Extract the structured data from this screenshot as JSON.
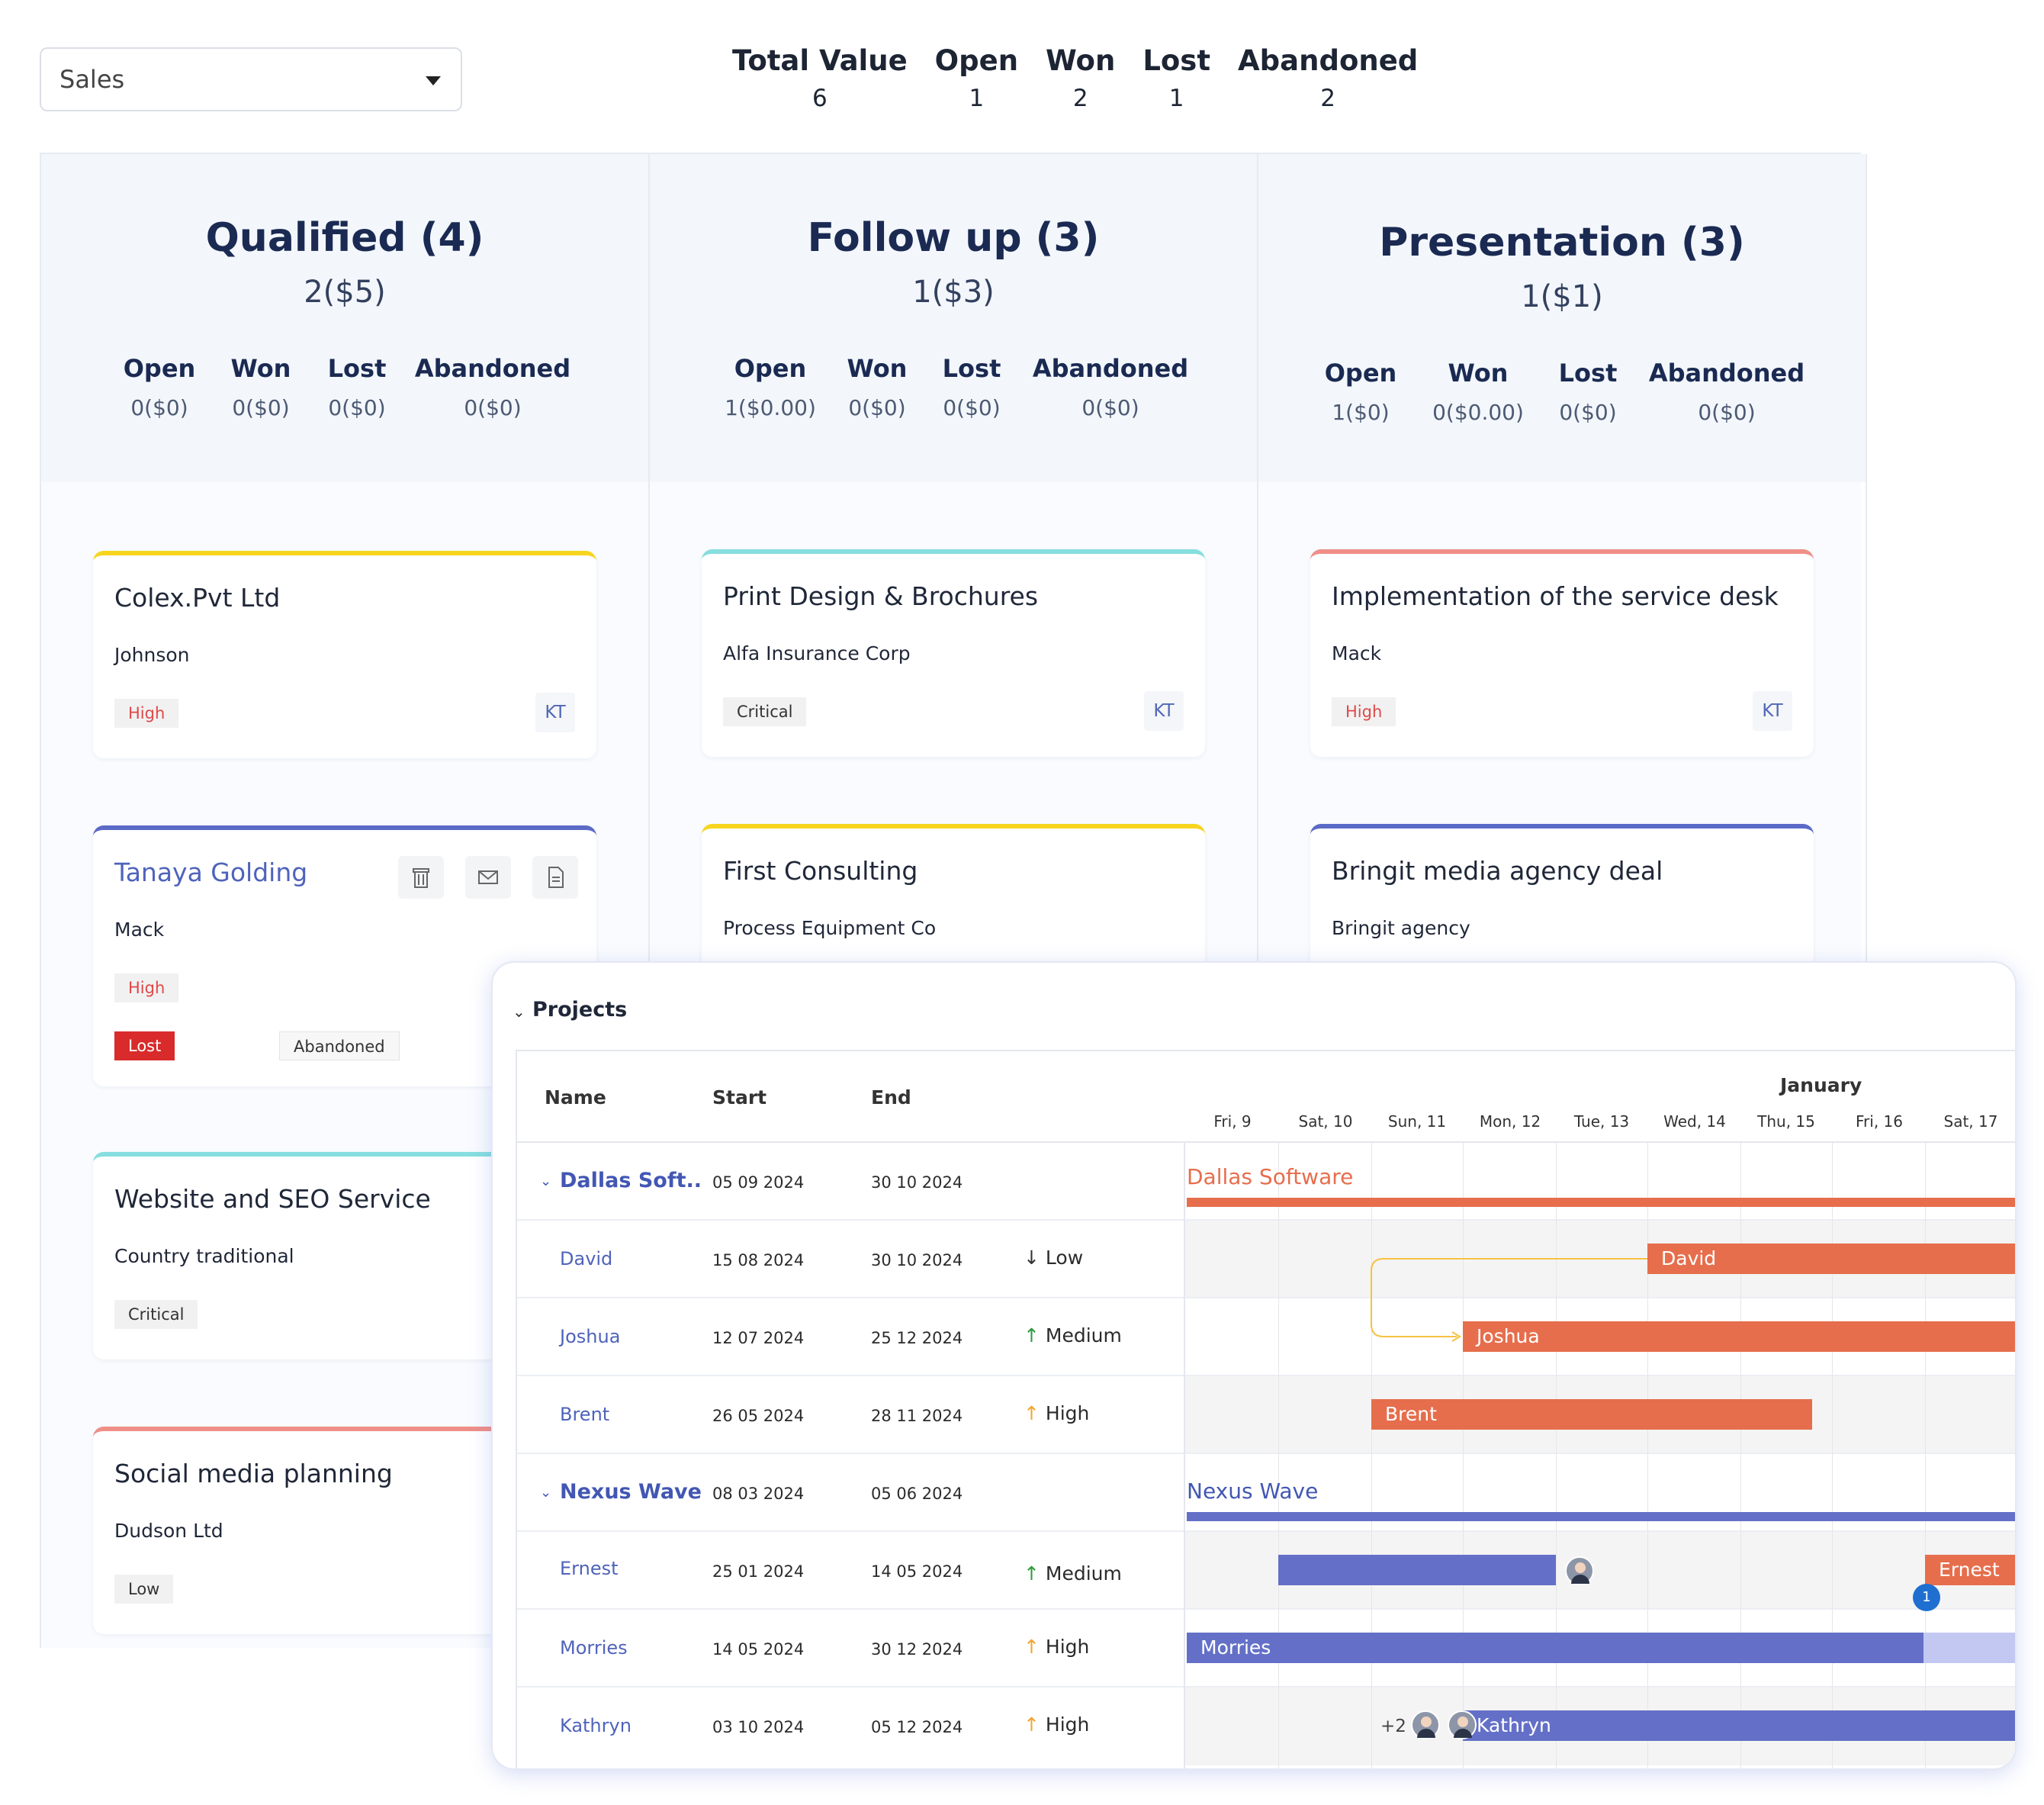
{
  "pipeline_select": {
    "value": "Sales"
  },
  "summary": [
    {
      "label": "Total Value",
      "value": "6"
    },
    {
      "label": "Open",
      "value": "1"
    },
    {
      "label": "Won",
      "value": "2"
    },
    {
      "label": "Lost",
      "value": "1"
    },
    {
      "label": "Abandoned",
      "value": "2"
    }
  ],
  "columns": [
    {
      "title": "Qualified (4)",
      "subtitle": "2($5)",
      "stats": [
        {
          "label": "Open",
          "value": "0($0)"
        },
        {
          "label": "Won",
          "value": "0($0)"
        },
        {
          "label": "Lost",
          "value": "0($0)"
        },
        {
          "label": "Abandoned",
          "value": "0($0)"
        }
      ],
      "cards": [
        {
          "title": "Colex.Pvt Ltd",
          "company": "Johnson",
          "priority": "High",
          "initials": "KT",
          "accent": "#f7d51e"
        },
        {
          "title": "Tanaya Golding",
          "company": "Mack",
          "priority": "High",
          "status_lost": "Lost",
          "status_abandoned": "Abandoned",
          "accent": "#5b6ac7"
        },
        {
          "title": "Website and SEO Service",
          "company": "Country traditional",
          "priority": "Critical",
          "accent": "#86dede"
        },
        {
          "title": "Social media planning",
          "company": "Dudson Ltd",
          "priority": "Low",
          "accent": "#ef8f88"
        }
      ]
    },
    {
      "title": "Follow up (3)",
      "subtitle": "1($3)",
      "stats": [
        {
          "label": "Open",
          "value": "1($0.00)"
        },
        {
          "label": "Won",
          "value": "0($0)"
        },
        {
          "label": "Lost",
          "value": "0($0)"
        },
        {
          "label": "Abandoned",
          "value": "0($0)"
        }
      ],
      "cards": [
        {
          "title": "Print Design & Brochures",
          "company": "Alfa Insurance Corp",
          "priority": "Critical",
          "initials": "KT",
          "accent": "#86dede"
        },
        {
          "title": "First Consulting",
          "company": "Process Equipment Co",
          "accent": "#f7d51e"
        }
      ]
    },
    {
      "title": "Presentation (3)",
      "subtitle": "1($1)",
      "stats": [
        {
          "label": "Open",
          "value": "1($0)"
        },
        {
          "label": "Won",
          "value": "0($0.00)"
        },
        {
          "label": "Lost",
          "value": "0($0)"
        },
        {
          "label": "Abandoned",
          "value": "0($0)"
        }
      ],
      "cards": [
        {
          "title": "Implementation of the service desk",
          "company": "Mack",
          "priority": "High",
          "initials": "KT",
          "accent": "#ef8f88"
        },
        {
          "title": "Bringit media agency deal",
          "company": "Bringit agency",
          "accent": "#5b6ac7"
        }
      ]
    }
  ],
  "gantt": {
    "title": "Projects",
    "headers": {
      "name": "Name",
      "start": "Start",
      "end": "End"
    },
    "month": "January",
    "days": [
      "Fri, 9",
      "Sat, 10",
      "Sun, 11",
      "Mon, 12",
      "Tue, 13",
      "Wed, 14",
      "Thu, 15",
      "Fri, 16",
      "Sat, 17"
    ],
    "rows": [
      {
        "name": "Dallas Soft..",
        "start": "05 09 2024",
        "end": "30 10 2024",
        "group": true,
        "bar_label": "Dallas Software",
        "color": "#e66e4c"
      },
      {
        "name": "David",
        "start": "15 08 2024",
        "end": "30 10 2024",
        "priority": "Low",
        "priority_icon": "arrow-down",
        "bar_label": "David",
        "color": "#e66e4c"
      },
      {
        "name": "Joshua",
        "start": "12 07 2024",
        "end": "25 12 2024",
        "priority": "Medium",
        "priority_icon": "arrow-up-green",
        "bar_label": "Joshua",
        "color": "#e66e4c"
      },
      {
        "name": "Brent",
        "start": "26 05 2024",
        "end": "28 11 2024",
        "priority": "High",
        "priority_icon": "arrow-up-orange",
        "bar_label": "Brent",
        "color": "#e66e4c"
      },
      {
        "name": "Nexus Wave",
        "start": "08 03 2024",
        "end": "05 06 2024",
        "group": true,
        "bar_label": "Nexus Wave",
        "color": "#6470c7"
      },
      {
        "name": "Ernest",
        "start": "25 01 2024",
        "end": "14 05 2024",
        "priority": "Medium",
        "priority_icon": "arrow-up-green",
        "bar_label": "Ernest",
        "color": "#e66e4c",
        "badge_count": "1"
      },
      {
        "name": "Morries",
        "start": "14 05 2024",
        "end": "30 12 2024",
        "priority": "High",
        "priority_icon": "arrow-up-orange",
        "bar_label": "Morries",
        "color": "#6470c7"
      },
      {
        "name": "Kathryn",
        "start": "03 10 2024",
        "end": "05 12 2024",
        "priority": "High",
        "priority_icon": "arrow-up-orange",
        "bar_label": "Kathryn",
        "color": "#6470c7",
        "extra_assignees": "+2"
      }
    ],
    "dependency_color": "#f5c242"
  }
}
